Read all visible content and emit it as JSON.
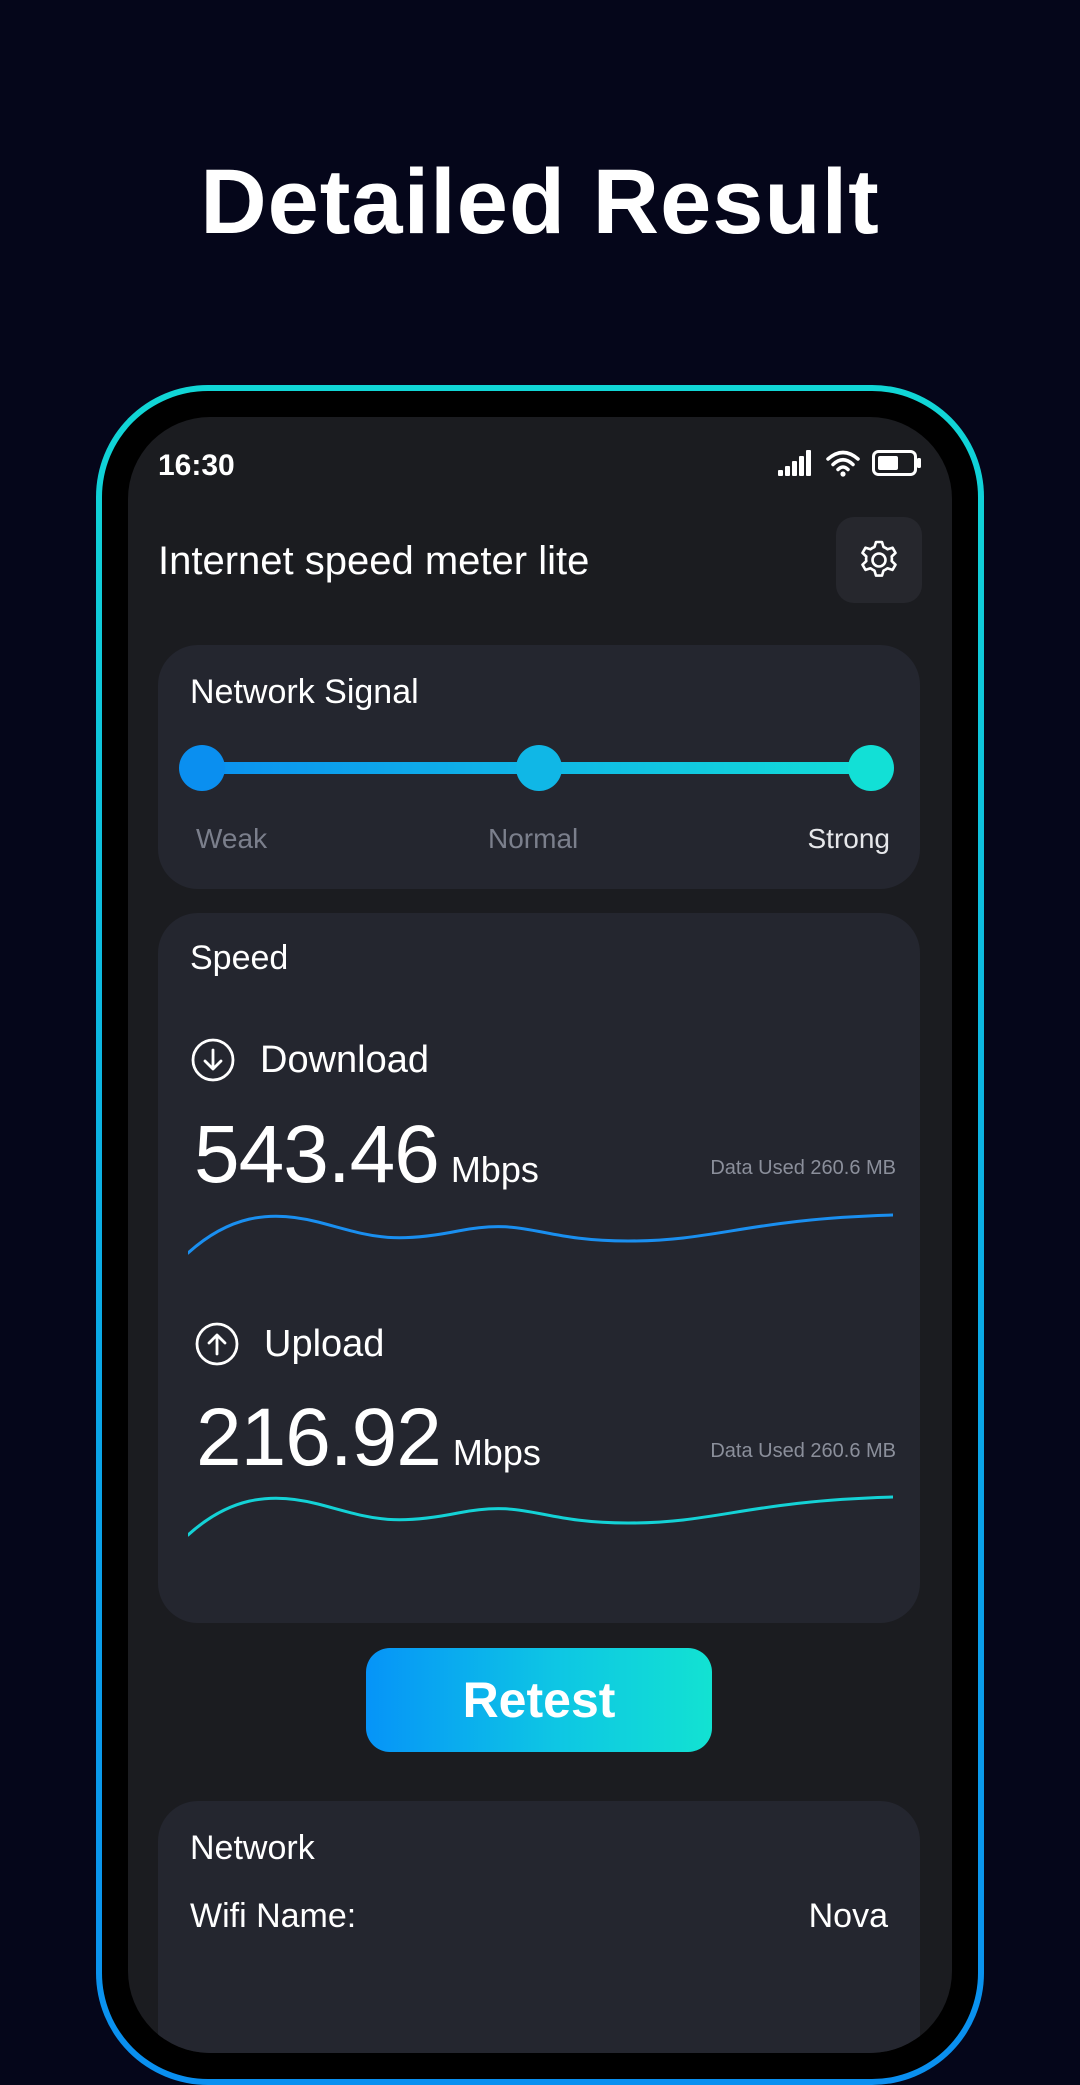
{
  "headline": "Detailed Result",
  "status_bar": {
    "time": "16:30",
    "icons": [
      "cellular-signal-icon",
      "wifi-icon",
      "battery-icon"
    ]
  },
  "app": {
    "title": "Internet speed meter lite",
    "settings_icon": "gear-icon"
  },
  "network_signal": {
    "title": "Network Signal",
    "levels": [
      "Weak",
      "Normal",
      "Strong"
    ],
    "current_level": "Strong"
  },
  "speed": {
    "title": "Speed",
    "download": {
      "label": "Download",
      "value": "543.46",
      "unit": "Mbps",
      "data_used": "Data Used 260.6 MB",
      "icon": "download-circle-icon",
      "color": "#1a8ff0"
    },
    "upload": {
      "label": "Upload",
      "value": "216.92",
      "unit": "Mbps",
      "data_used": "Data Used 260.6 MB",
      "icon": "upload-circle-icon",
      "color": "#14d2d6"
    }
  },
  "retest_label": "Retest",
  "network": {
    "title": "Network",
    "wifi_name_label": "Wifi Name:",
    "wifi_name_value": "Nova"
  },
  "colors": {
    "background": "#05061a",
    "accent_blue": "#0a8ff0",
    "accent_cyan": "#12e0d6",
    "card": "#24262f",
    "screen": "#1b1c20"
  }
}
